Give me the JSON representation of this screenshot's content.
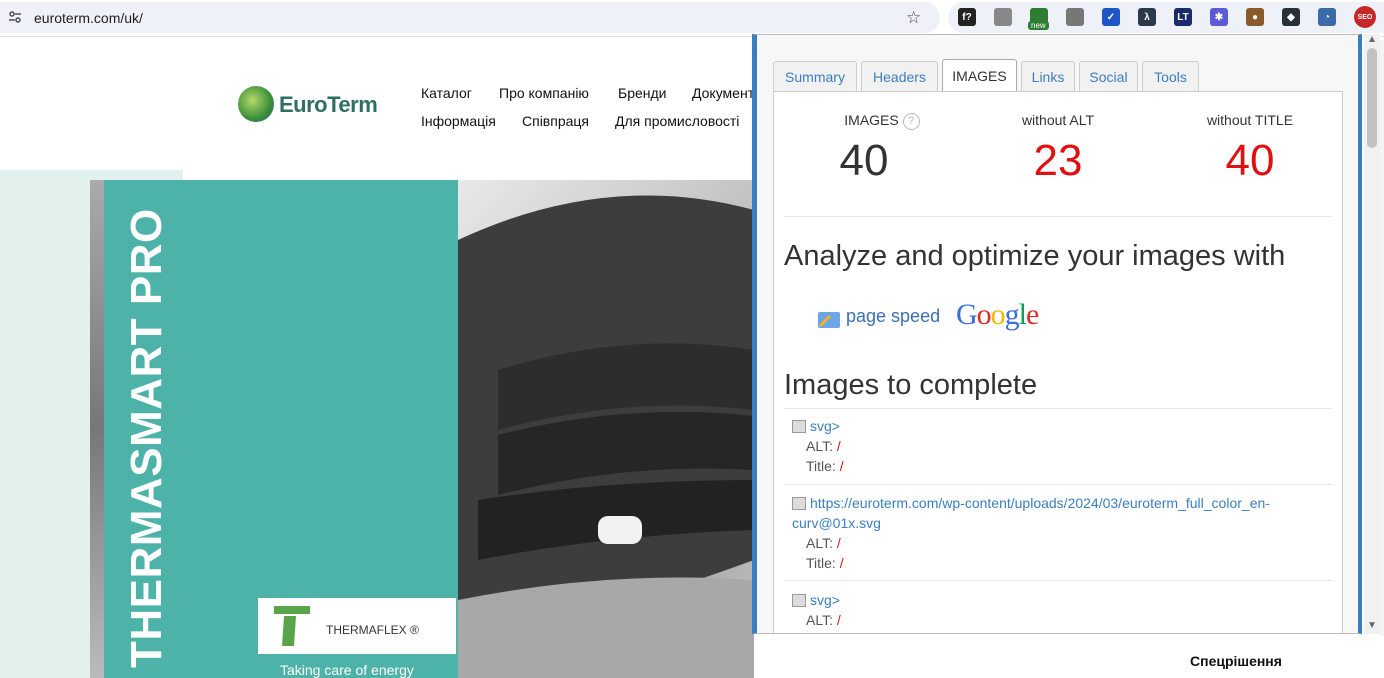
{
  "browser": {
    "url": "euroterm.com/uk/",
    "extensions": [
      {
        "name": "fontface-ext",
        "label": "f?",
        "color": "#222"
      },
      {
        "name": "moon-ext",
        "label": "",
        "color": "#888"
      },
      {
        "name": "new-ext",
        "label": "",
        "color": "#2e7d32",
        "badge": "new"
      },
      {
        "name": "camera-ext",
        "label": "",
        "color": "#777"
      },
      {
        "name": "check-ext",
        "label": "✓",
        "color": "#1e56c7"
      },
      {
        "name": "lambda-ext",
        "label": "λ",
        "color": "#2a3a4a"
      },
      {
        "name": "lt-ext",
        "label": "LT",
        "color": "#1b2a6b"
      },
      {
        "name": "gear-ext",
        "label": "✱",
        "color": "#5b5bd6"
      },
      {
        "name": "cookie-ext",
        "label": "●",
        "color": "#8b5a2b"
      },
      {
        "name": "hex-ext",
        "label": "◆",
        "color": "#263238"
      },
      {
        "name": "stats-ext",
        "label": "◔",
        "color": "#3b6aa8"
      },
      {
        "name": "seo-ext",
        "label": "SEO",
        "color": "#c62828"
      }
    ]
  },
  "site": {
    "logo_text": "EuroTerm",
    "nav": [
      "Каталог",
      "Про компанію",
      "Бренди",
      "Документ",
      "Інформація",
      "Співпраця",
      "Для промисловості"
    ],
    "banner_title": "THERMASMART PRO",
    "brand": "THERMAFLEX ®",
    "tagline": "Taking care of energy",
    "side_heading": "Спецрішення"
  },
  "popup": {
    "tabs": [
      "Summary",
      "Headers",
      "IMAGES",
      "Links",
      "Social",
      "Tools"
    ],
    "active_tab": "IMAGES",
    "stats": [
      {
        "label": "IMAGES",
        "value": "40",
        "color": "#333"
      },
      {
        "label": "without ALT",
        "value": "23",
        "color": "#e01010"
      },
      {
        "label": "without TITLE",
        "value": "40",
        "color": "#e01010"
      }
    ],
    "help_glyph": "?",
    "analyze_heading": "Analyze and optimize your images with",
    "pagespeed_label": "page speed",
    "google_label": "Google",
    "complete_heading": "Images to complete",
    "alt_label": "ALT:",
    "title_label": "Title:",
    "slash": "/",
    "images": [
      {
        "src": "svg>"
      },
      {
        "src": "https://euroterm.com/wp-content/uploads/2024/03/euroterm_full_color_en-curv@01x.svg"
      },
      {
        "src": "svg>"
      }
    ]
  }
}
